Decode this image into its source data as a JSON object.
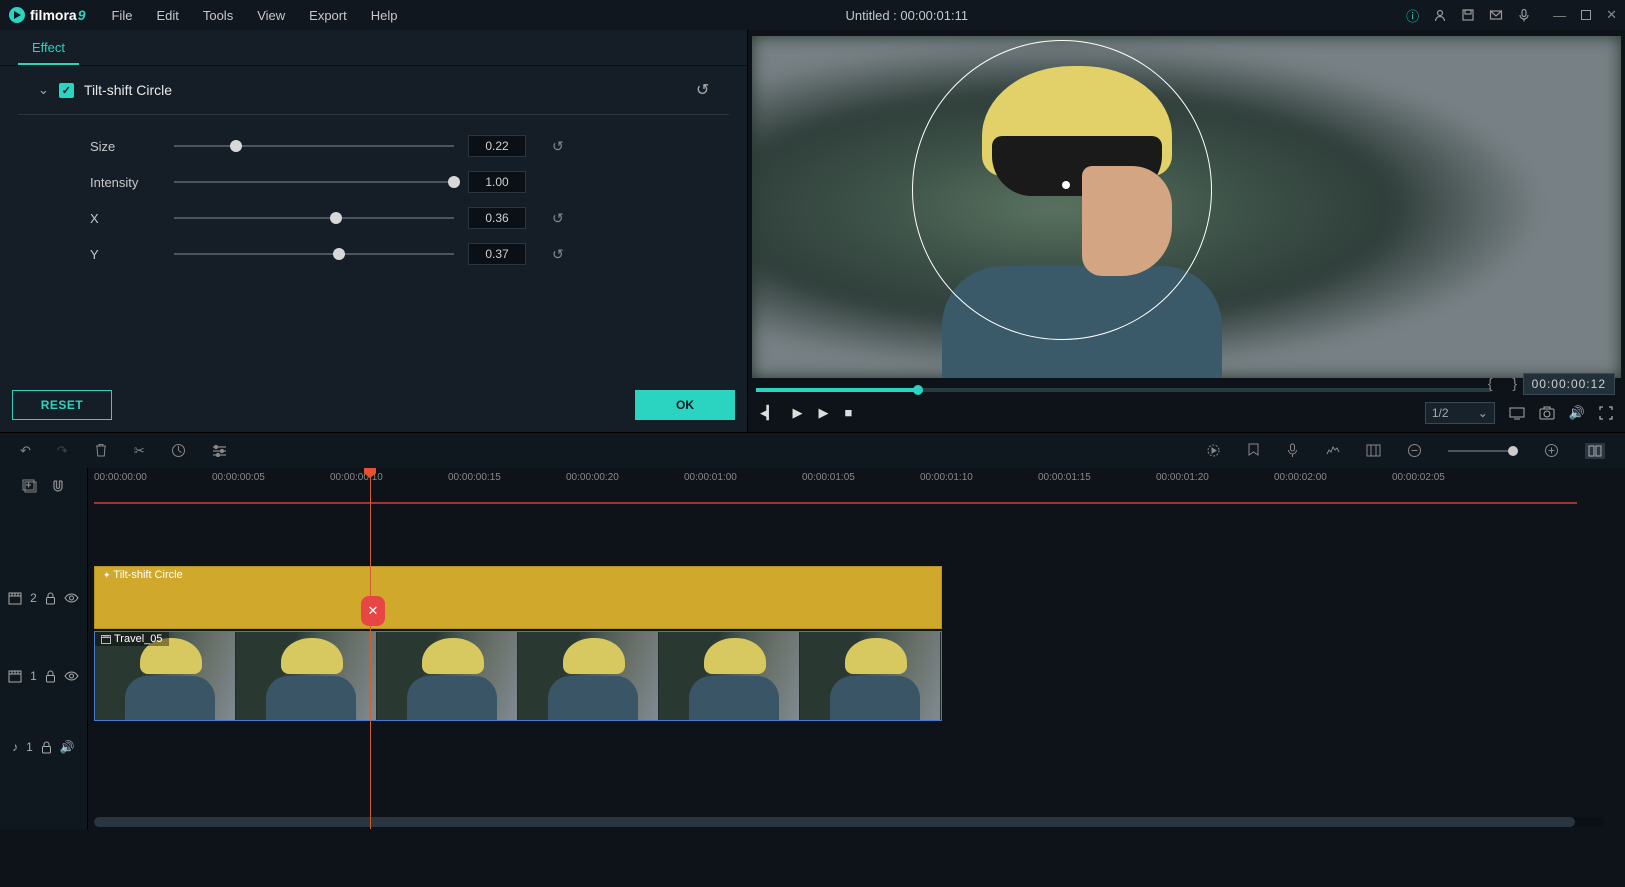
{
  "app": {
    "name": "filmora",
    "version": "9",
    "title": "Untitled : 00:00:01:11"
  },
  "menu": {
    "file": "File",
    "edit": "Edit",
    "tools": "Tools",
    "view": "View",
    "export": "Export",
    "help": "Help"
  },
  "panel": {
    "tab": "Effect",
    "effect_name": "Tilt-shift Circle",
    "sliders": {
      "size": {
        "label": "Size",
        "value": "0.22",
        "pct": 22
      },
      "intensity": {
        "label": "Intensity",
        "value": "1.00",
        "pct": 100
      },
      "x": {
        "label": "X",
        "value": "0.36",
        "pct": 58
      },
      "y": {
        "label": "Y",
        "value": "0.37",
        "pct": 59
      }
    },
    "reset": "RESET",
    "ok": "OK"
  },
  "preview": {
    "timecode": "00:00:00:12",
    "zoom": "1/2"
  },
  "ruler": [
    "00:00:00:00",
    "00:00:00:05",
    "00:00:00:10",
    "00:00:00:15",
    "00:00:00:20",
    "00:00:01:00",
    "00:00:01:05",
    "00:00:01:10",
    "00:00:01:15",
    "00:00:01:20",
    "00:00:02:00",
    "00:00:02:05"
  ],
  "tracks": {
    "fx": {
      "index": "2",
      "clip_label": "Tilt-shift Circle"
    },
    "video": {
      "index": "1",
      "clip_label": "Travel_05"
    },
    "audio": {
      "index": "1"
    }
  }
}
